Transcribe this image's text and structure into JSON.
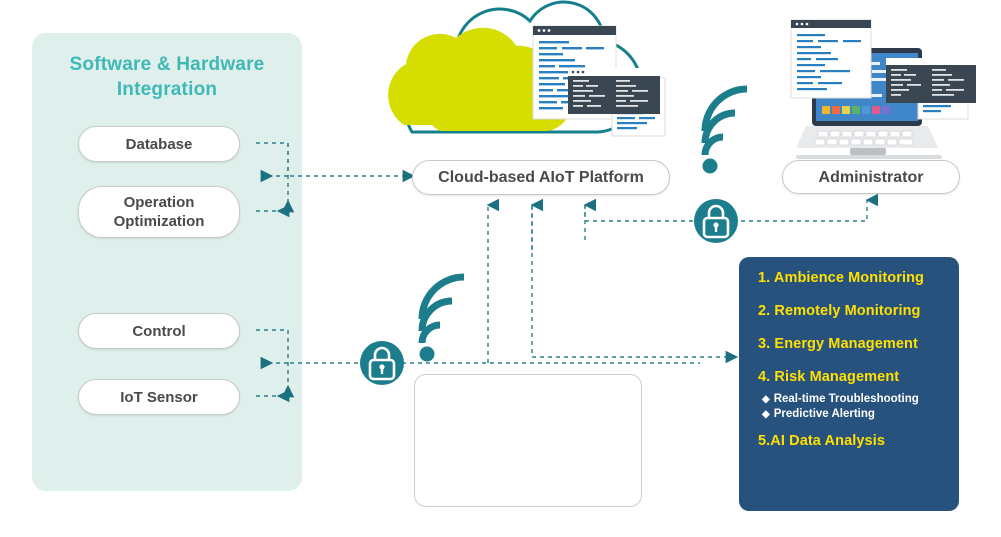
{
  "diagram": {
    "title": "Cloud-based AIoT Platform architecture diagram",
    "colors": {
      "mint_panel": "#dff0ec",
      "teal_title": "#3fb8b8",
      "teal_accent": "#2b7f8c",
      "navy_panel": "#27527d",
      "yellow_text": "#ffe000",
      "cloud_green": "#d6dd00",
      "pill_text": "#4a4a4a"
    }
  },
  "left_panel": {
    "title": "Software & Hardware Integration",
    "title_line1": "Software & Hardware",
    "title_line2": "Integration",
    "nodes": [
      {
        "id": "database",
        "label": "Database"
      },
      {
        "id": "operation-optimization",
        "label": "Operation Optimization",
        "line1": "Operation",
        "line2": "Optimization"
      },
      {
        "id": "control",
        "label": "Control"
      },
      {
        "id": "iot-sensor",
        "label": "IoT Sensor"
      }
    ]
  },
  "center": {
    "platform_label": "Cloud-based AIoT Platform",
    "cloud_icon": "cloud-icon",
    "code_windows": [
      "code-window-light",
      "code-window-dark",
      "code-window-small"
    ],
    "wifi_icon": "wifi-icon",
    "lock_icon": "lock-icon",
    "devices": [
      {
        "id": "touch-panel",
        "name": "touch-panel-device"
      },
      {
        "id": "alarm-button",
        "name": "alarm-button-device"
      },
      {
        "id": "motion-detector",
        "name": "motion-detector-device"
      },
      {
        "id": "ip-camera",
        "name": "ip-camera-device"
      },
      {
        "id": "wall-switch",
        "name": "wall-switch-device"
      },
      {
        "id": "motion-sensor-cube",
        "name": "motion-sensor-cube-device"
      }
    ]
  },
  "right": {
    "administrator_label": "Administrator",
    "laptop_icon": "laptop-icon",
    "wifi_icon": "wifi-icon",
    "lock_icon": "lock-icon",
    "features": [
      {
        "text": "1. Ambience Monitoring",
        "type": "numbered"
      },
      {
        "text": "2. Remotely Monitoring",
        "type": "numbered"
      },
      {
        "text": "3. Energy Management",
        "type": "numbered"
      },
      {
        "text": "4. Risk Management",
        "type": "numbered"
      },
      {
        "text": "Real-time Troubleshooting",
        "type": "bullet",
        "marker": "◆"
      },
      {
        "text": "Predictive Alerting",
        "type": "bullet",
        "marker": "◆"
      },
      {
        "text": "5.AI Data Analysis",
        "type": "numbered"
      }
    ]
  }
}
